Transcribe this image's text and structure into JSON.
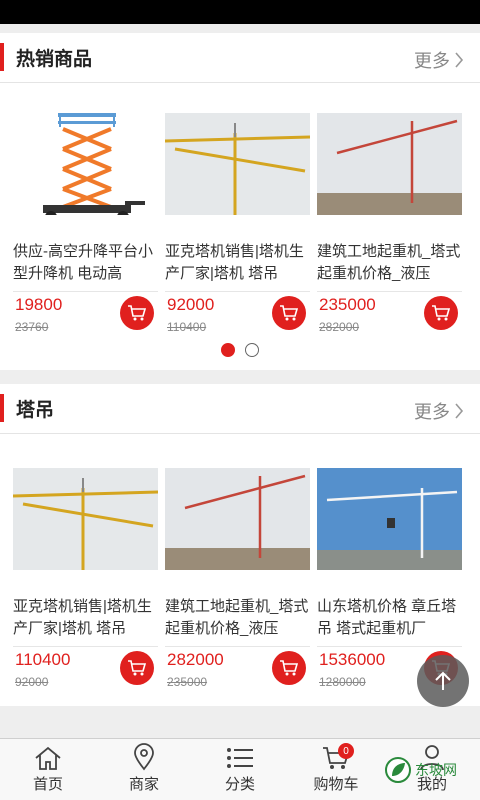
{
  "colors": {
    "accent": "#e0201e"
  },
  "hot": {
    "title": "热销商品",
    "more": "更多",
    "items": [
      {
        "name": "供应-高空升降平台小型升降机 电动高",
        "price": "19800",
        "old_price": "23760",
        "image": "scissor-lift"
      },
      {
        "name": "亚克塔机销售|塔机生产厂家|塔机 塔吊",
        "price": "92000",
        "old_price": "110400",
        "image": "tower-crane-yellow"
      },
      {
        "name": "建筑工地起重机_塔式起重机价格_液压",
        "price": "235000",
        "old_price": "282000",
        "image": "tower-crane-red"
      }
    ]
  },
  "crane": {
    "title": "塔吊",
    "more": "更多",
    "items": [
      {
        "name": "亚克塔机销售|塔机生产厂家|塔机 塔吊",
        "price": "110400",
        "old_price": "92000",
        "image": "tower-crane-yellow"
      },
      {
        "name": "建筑工地起重机_塔式起重机价格_液压",
        "price": "282000",
        "old_price": "235000",
        "image": "tower-crane-red"
      },
      {
        "name": "山东塔机价格 章丘塔吊 塔式起重机厂",
        "price": "1536000",
        "old_price": "1280000",
        "image": "tower-crane-blue-sky"
      }
    ]
  },
  "carousel": {
    "pages": 2,
    "active": 0
  },
  "tabs": [
    {
      "label": "首页",
      "icon": "home-icon"
    },
    {
      "label": "商家",
      "icon": "location-icon"
    },
    {
      "label": "分类",
      "icon": "list-icon"
    },
    {
      "label": "购物车",
      "icon": "cart-icon",
      "badge": "0"
    },
    {
      "label": "我的",
      "icon": "user-icon"
    }
  ],
  "watermark": "东坡网"
}
